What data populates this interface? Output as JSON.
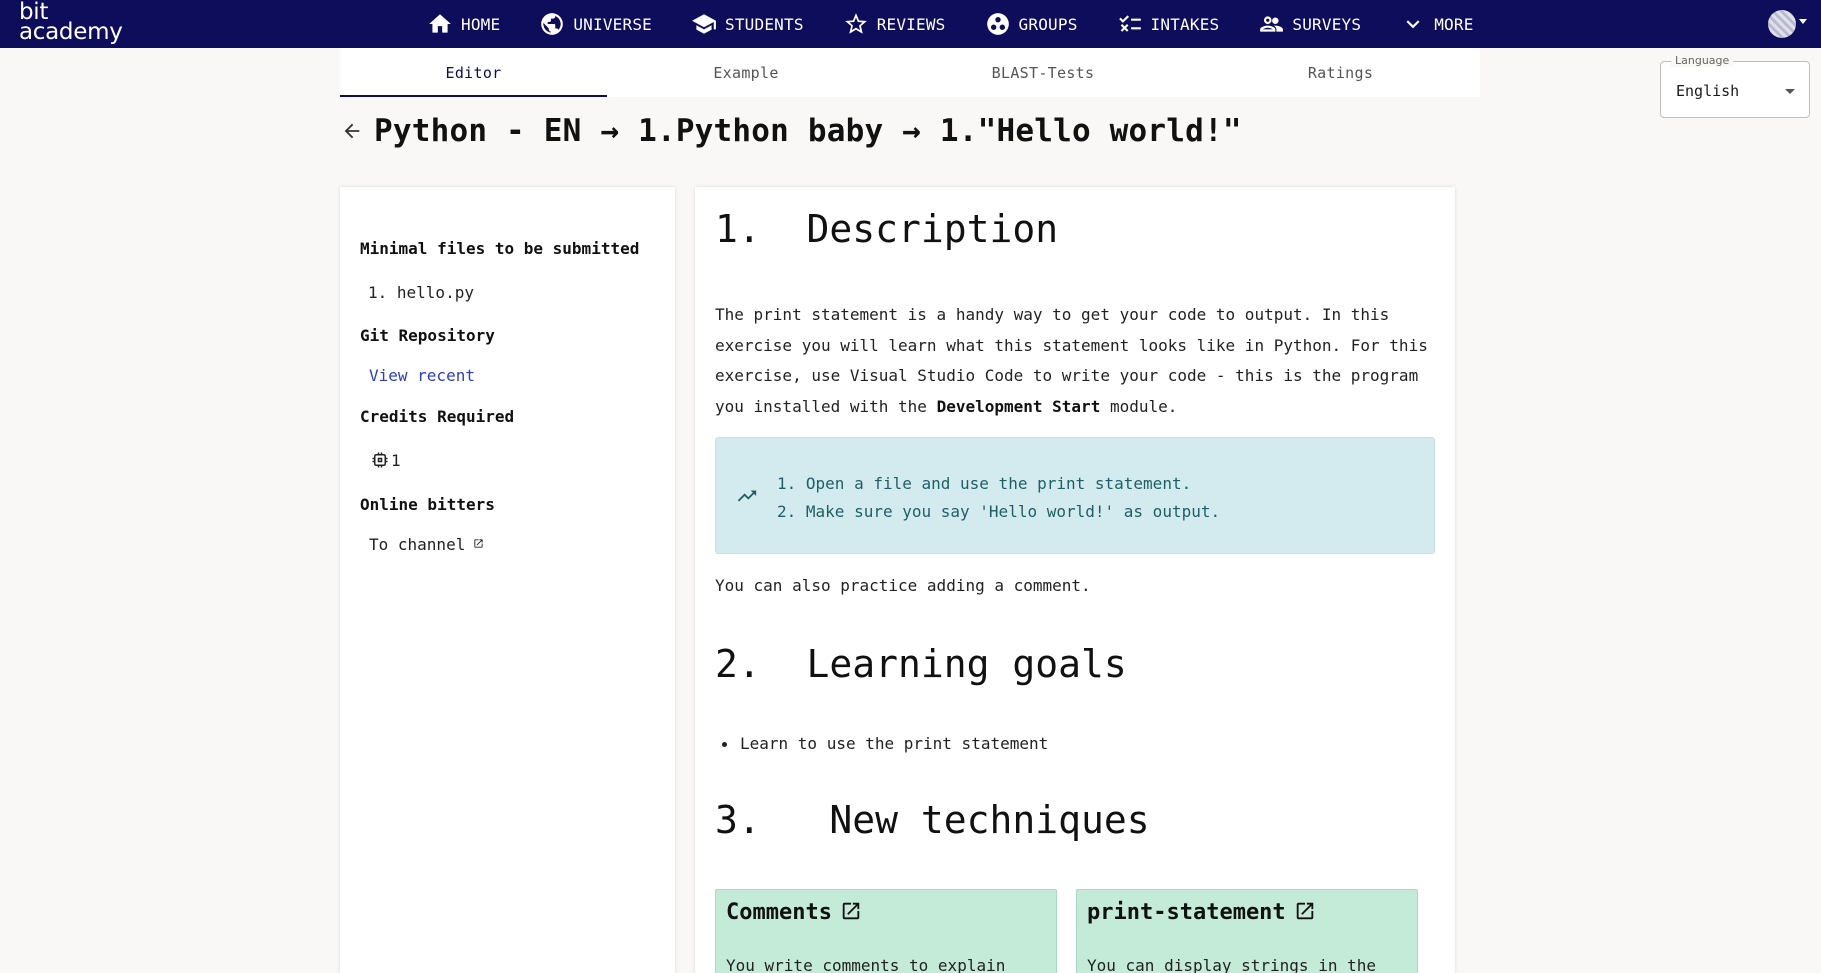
{
  "brand": {
    "line1": "bit",
    "line2": "academy"
  },
  "nav": {
    "items": [
      {
        "label": "HOME",
        "icon": "home-icon"
      },
      {
        "label": "UNIVERSE",
        "icon": "globe-icon"
      },
      {
        "label": "STUDENTS",
        "icon": "graduation-cap-icon"
      },
      {
        "label": "REVIEWS",
        "icon": "star-icon"
      },
      {
        "label": "GROUPS",
        "icon": "groups-icon"
      },
      {
        "label": "INTAKES",
        "icon": "checklist-icon"
      },
      {
        "label": "SURVEYS",
        "icon": "people-icon"
      },
      {
        "label": "MORE",
        "icon": "chevron-down-icon"
      }
    ]
  },
  "tabs": [
    {
      "label": "Editor",
      "active": true
    },
    {
      "label": "Example",
      "active": false
    },
    {
      "label": "BLAST-Tests",
      "active": false
    },
    {
      "label": "Ratings",
      "active": false
    }
  ],
  "language": {
    "legend": "Language",
    "value": "English"
  },
  "title": "Python - EN → 1.Python baby → 1.\"Hello world!\"",
  "sidebar": {
    "files_heading": "Minimal files to be submitted",
    "files": [
      "1. hello.py"
    ],
    "git_heading": "Git Repository",
    "git_link": "View recent",
    "credits_heading": "Credits Required",
    "credits_value": "1",
    "online_heading": "Online bitters",
    "online_link": "To channel"
  },
  "main": {
    "description_heading": "1.  Description",
    "description_pre": "The print statement is a handy way to get your code to output. In this exercise you will learn what this statement looks like in Python. For this exercise, use Visual Studio Code to write your code - this is the program you installed with the ",
    "description_bold": "Development Start",
    "description_post": " module.",
    "info_items": [
      "1. Open a file and use the print statement.",
      "2. Make sure you say 'Hello world!' as output."
    ],
    "comment_note": "You can also practice adding a comment.",
    "goals_heading": "2.  Learning goals",
    "goals": [
      "Learn to use the print statement"
    ],
    "techniques_heading": "3.   New techniques",
    "techniques": [
      {
        "title": "Comments",
        "desc": "You write comments to explain"
      },
      {
        "title": "print-statement",
        "desc": "You can display strings in the"
      }
    ]
  },
  "colors": {
    "navbar": "#0d0d5c",
    "info_box": "#d3ebee",
    "technique_card": "#c4ead8",
    "link": "#2c3ec2"
  }
}
